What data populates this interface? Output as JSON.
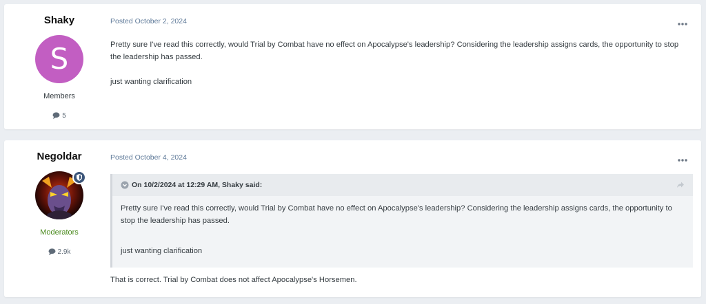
{
  "posts": [
    {
      "author": "Shaky",
      "avatar_letter": "S",
      "group": "Members",
      "post_count": "5",
      "posted_label": "Posted",
      "posted_date": "October 2, 2024",
      "paragraphs": [
        "Pretty sure I've read this correctly, would Trial by Combat have no effect on Apocalypse's leadership? Considering the leadership assigns cards, the opportunity to stop the leadership has passed.",
        "just wanting clarification"
      ]
    },
    {
      "author": "Negoldar",
      "group": "Moderators",
      "post_count": "2.9k",
      "posted_label": "Posted",
      "posted_date": "October 4, 2024",
      "quote": {
        "header": "On 10/2/2024 at 12:29 AM, Shaky said:",
        "paragraphs": [
          "Pretty sure I've read this correctly, would Trial by Combat have no effect on Apocalypse's leadership? Considering the leadership assigns cards, the opportunity to stop the leadership has passed.",
          "just wanting clarification"
        ]
      },
      "reply": "That is correct. Trial by Combat does not affect Apocalypse's Horsemen."
    }
  ],
  "colors": {
    "avatar_bg": "#c25ec2",
    "moderator_group": "#4a8a1d",
    "meta_text": "#5f7a99",
    "page_bg": "#ebeef2"
  },
  "icons": [
    "comment-icon",
    "ellipsis-icon",
    "shield-icon",
    "chevron-down-icon",
    "share-icon"
  ]
}
